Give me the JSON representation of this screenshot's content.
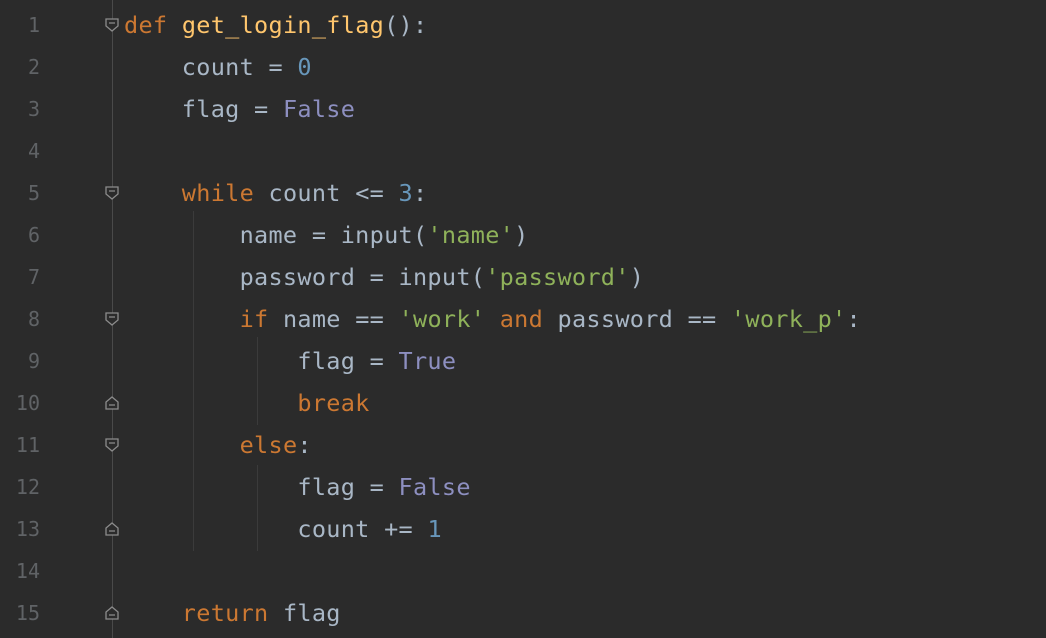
{
  "editor": {
    "lines": [
      {
        "num": "1",
        "tokens": [
          {
            "t": "def",
            "c": "kw"
          },
          {
            "t": " ",
            "c": "var"
          },
          {
            "t": "get_login_flag",
            "c": "fn"
          },
          {
            "t": "():",
            "c": "var"
          }
        ]
      },
      {
        "num": "2",
        "tokens": [
          {
            "t": "    count ",
            "c": "var"
          },
          {
            "t": "=",
            "c": "op"
          },
          {
            "t": " ",
            "c": "var"
          },
          {
            "t": "0",
            "c": "num"
          }
        ]
      },
      {
        "num": "3",
        "tokens": [
          {
            "t": "    flag ",
            "c": "var"
          },
          {
            "t": "=",
            "c": "op"
          },
          {
            "t": " ",
            "c": "var"
          },
          {
            "t": "False",
            "c": "const"
          }
        ]
      },
      {
        "num": "4",
        "tokens": []
      },
      {
        "num": "5",
        "tokens": [
          {
            "t": "    ",
            "c": "var"
          },
          {
            "t": "while",
            "c": "kw"
          },
          {
            "t": " count ",
            "c": "var"
          },
          {
            "t": "<=",
            "c": "op"
          },
          {
            "t": " ",
            "c": "var"
          },
          {
            "t": "3",
            "c": "num"
          },
          {
            "t": ":",
            "c": "var"
          }
        ]
      },
      {
        "num": "6",
        "tokens": [
          {
            "t": "        name ",
            "c": "var"
          },
          {
            "t": "=",
            "c": "op"
          },
          {
            "t": " input(",
            "c": "var"
          },
          {
            "t": "'name'",
            "c": "str"
          },
          {
            "t": ")",
            "c": "var"
          }
        ]
      },
      {
        "num": "7",
        "tokens": [
          {
            "t": "        password ",
            "c": "var"
          },
          {
            "t": "=",
            "c": "op"
          },
          {
            "t": " input(",
            "c": "var"
          },
          {
            "t": "'password'",
            "c": "str"
          },
          {
            "t": ")",
            "c": "var"
          }
        ]
      },
      {
        "num": "8",
        "tokens": [
          {
            "t": "        ",
            "c": "var"
          },
          {
            "t": "if",
            "c": "kw"
          },
          {
            "t": " name ",
            "c": "var"
          },
          {
            "t": "==",
            "c": "op"
          },
          {
            "t": " ",
            "c": "var"
          },
          {
            "t": "'work'",
            "c": "str"
          },
          {
            "t": " ",
            "c": "var"
          },
          {
            "t": "and",
            "c": "kw"
          },
          {
            "t": " password ",
            "c": "var"
          },
          {
            "t": "==",
            "c": "op"
          },
          {
            "t": " ",
            "c": "var"
          },
          {
            "t": "'work_p'",
            "c": "str"
          },
          {
            "t": ":",
            "c": "var"
          }
        ]
      },
      {
        "num": "9",
        "tokens": [
          {
            "t": "            flag ",
            "c": "var"
          },
          {
            "t": "=",
            "c": "op"
          },
          {
            "t": " ",
            "c": "var"
          },
          {
            "t": "True",
            "c": "const"
          }
        ]
      },
      {
        "num": "10",
        "tokens": [
          {
            "t": "            ",
            "c": "var"
          },
          {
            "t": "break",
            "c": "kw"
          }
        ]
      },
      {
        "num": "11",
        "tokens": [
          {
            "t": "        ",
            "c": "var"
          },
          {
            "t": "else",
            "c": "kw"
          },
          {
            "t": ":",
            "c": "var"
          }
        ]
      },
      {
        "num": "12",
        "tokens": [
          {
            "t": "            flag ",
            "c": "var"
          },
          {
            "t": "=",
            "c": "op"
          },
          {
            "t": " ",
            "c": "var"
          },
          {
            "t": "False",
            "c": "const"
          }
        ]
      },
      {
        "num": "13",
        "tokens": [
          {
            "t": "            count ",
            "c": "var"
          },
          {
            "t": "+=",
            "c": "op"
          },
          {
            "t": " ",
            "c": "var"
          },
          {
            "t": "1",
            "c": "num"
          }
        ]
      },
      {
        "num": "14",
        "tokens": []
      },
      {
        "num": "15",
        "tokens": [
          {
            "t": "    ",
            "c": "var"
          },
          {
            "t": "return",
            "c": "kw"
          },
          {
            "t": " flag",
            "c": "var"
          }
        ]
      }
    ],
    "folds": [
      {
        "line": "1",
        "type": "fold-open-icon"
      },
      {
        "line": "5",
        "type": "fold-open-icon"
      },
      {
        "line": "8",
        "type": "fold-open-icon"
      },
      {
        "line": "10",
        "type": "fold-close-icon"
      },
      {
        "line": "11",
        "type": "fold-open-icon"
      },
      {
        "line": "13",
        "type": "fold-close-icon"
      },
      {
        "line": "15",
        "type": "fold-close-icon"
      }
    ]
  }
}
